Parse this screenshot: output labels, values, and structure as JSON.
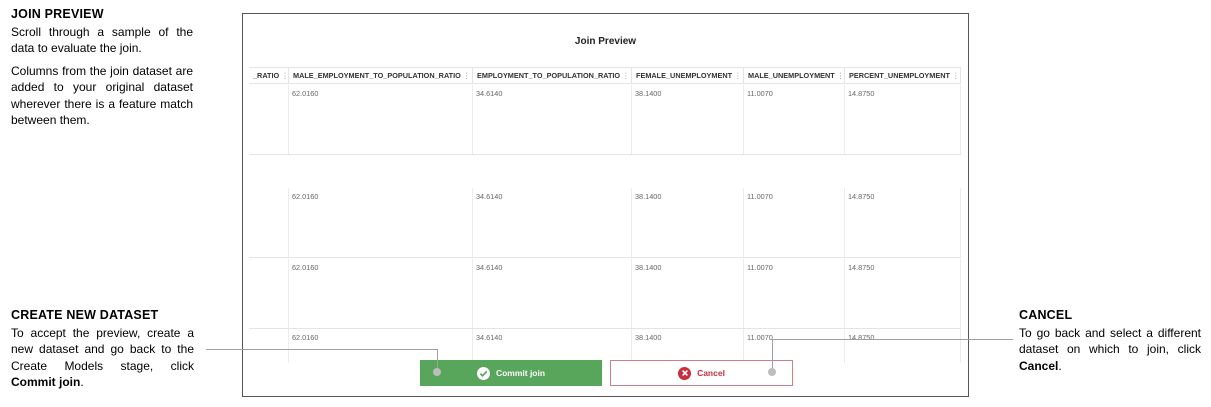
{
  "annotations": {
    "join_preview": {
      "title": "JOIN PREVIEW",
      "p1": "Scroll through a sample of the data to evaluate the join.",
      "p2": "Columns from the join dataset are added to your original dataset wherever there is a feature match between them."
    },
    "create_new_dataset": {
      "title": "CREATE NEW DATASET",
      "text": "To accept the preview, create a new dataset and go back to the Create Models stage, click ",
      "bold": "Commit join",
      "end": "."
    },
    "cancel": {
      "title": "CANCEL",
      "text": "To go back and select a different dataset on which to join, click ",
      "bold": "Cancel",
      "end": "."
    }
  },
  "dialog": {
    "title": "Join Preview",
    "columns": [
      "_RATIO",
      "MALE_EMPLOYMENT_TO_POPULATION_RATIO",
      "EMPLOYMENT_TO_POPULATION_RATIO",
      "FEMALE_UNEMPLOYMENT",
      "MALE_UNEMPLOYMENT",
      "PERCENT_UNEMPLOYMENT"
    ],
    "rows": [
      [
        "",
        "62.0160",
        "34.6140",
        "38.1400",
        "11.0070",
        "14.8750"
      ],
      [
        "",
        "62.0160",
        "34.6140",
        "38.1400",
        "11.0070",
        "14.8750"
      ],
      [
        "",
        "62.0160",
        "34.6140",
        "38.1400",
        "11.0070",
        "14.8750"
      ],
      [
        "",
        "62.0160",
        "34.6140",
        "38.1400",
        "11.0070",
        "14.8750"
      ]
    ],
    "commit_label": "Commit join",
    "cancel_label": "Cancel"
  },
  "icons": {
    "commit": "check-circle-icon",
    "cancel": "x-circle-icon",
    "column_menu": "column-menu-icon"
  },
  "colors": {
    "commit_bg": "#58a55c",
    "cancel_text": "#c62f3f",
    "cancel_border": "#c9808a"
  }
}
